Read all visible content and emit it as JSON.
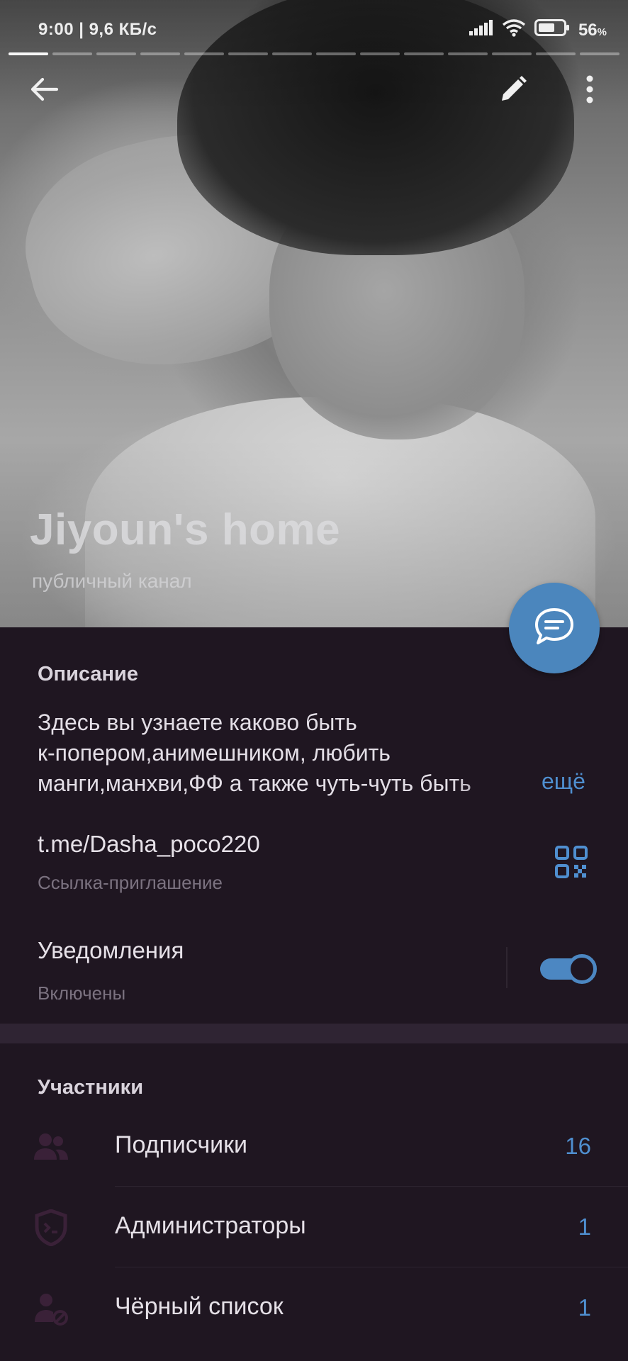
{
  "status_bar": {
    "time_speed": "9:00 | 9,6 КБ/с",
    "battery_percent": "56",
    "battery_unit": "%",
    "icons": [
      "signal-icon",
      "wifi-icon",
      "battery-icon"
    ]
  },
  "story_progress": {
    "segments": 14,
    "active_index": 0
  },
  "header": {
    "title": "Jiyoun's home",
    "subtitle": "публичный канал",
    "actions": [
      "back-arrow-icon",
      "edit-pencil-icon",
      "more-vertical-icon"
    ]
  },
  "description": {
    "heading": "Описание",
    "lines": [
      "Здесь вы узнаете каково быть",
      "к-попером,анимешником, любить",
      "манги,манхви,ФФ а также чуть-чуть быть"
    ],
    "more_label": "ещё"
  },
  "invite_link": {
    "value": "t.me/Dasha_poco220",
    "label": "Ссылка-приглашение"
  },
  "notifications": {
    "title": "Уведомления",
    "status": "Включены",
    "enabled": true
  },
  "members": {
    "heading": "Участники",
    "items": [
      {
        "label": "Подписчики",
        "count": "16",
        "icon": "subscribers-icon"
      },
      {
        "label": "Администраторы",
        "count": "1",
        "icon": "admin-shield-icon"
      },
      {
        "label": "Чёрный список",
        "count": "1",
        "icon": "blacklist-icon"
      }
    ]
  },
  "colors": {
    "background": "#1f1621",
    "accent": "#4c87c2",
    "section_gap": "#2f2433",
    "muted_icon": "#3a2138"
  }
}
